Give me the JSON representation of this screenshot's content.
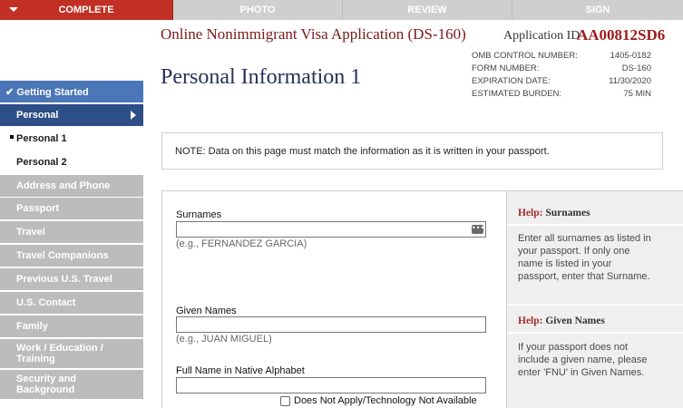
{
  "tabs": [
    "COMPLETE",
    "PHOTO",
    "REVIEW",
    "SIGN"
  ],
  "header": {
    "app_title": "Online Nonimmigrant Visa Application (DS-160)",
    "app_id_label": "Application ID",
    "app_id": "AA00812SD6",
    "page_title": "Personal Information 1",
    "meta": [
      {
        "label": "OMB CONTROL NUMBER:",
        "value": "1405-0182"
      },
      {
        "label": "FORM NUMBER:",
        "value": "DS-160"
      },
      {
        "label": "EXPIRATION DATE:",
        "value": "11/30/2020"
      },
      {
        "label": "ESTIMATED BURDEN:",
        "value": "75 MIN"
      }
    ]
  },
  "sidebar": [
    "✔ Getting Started",
    "Personal",
    "Personal 1",
    "Personal 2",
    "Address and Phone",
    "Passport",
    "Travel",
    "Travel Companions",
    "Previous U.S. Travel",
    "U.S. Contact",
    "Family",
    "Work / Education / Training",
    "Security and Background"
  ],
  "note": "NOTE: Data on this page must match the information as it is written in your passport.",
  "form": {
    "surnames_label": "Surnames",
    "surnames_hint": "(e.g., FERNANDEZ GARCIA)",
    "given_label": "Given Names",
    "given_hint": "(e.g., JUAN MIGUEL)",
    "native_label": "Full Name in Native Alphabet",
    "dna_label": "Does Not Apply/Technology Not Available"
  },
  "help": {
    "prefix": "Help:",
    "surnames_title": "Surnames",
    "surnames_text": "Enter all surnames as listed in your passport. If only one name is listed in your passport, enter that Surname.",
    "given_title": "Given Names",
    "given_text": "If your passport does not include a given name, please enter 'FNU' in Given Names."
  }
}
